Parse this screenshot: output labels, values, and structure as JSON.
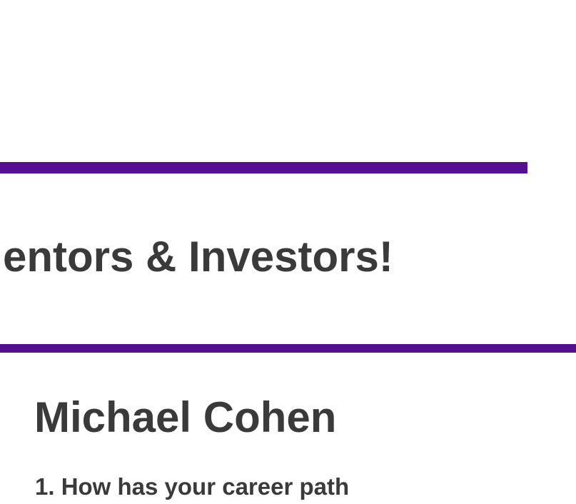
{
  "section": {
    "heading": "entors & Investors!",
    "accent_color": "#55118d"
  },
  "profile": {
    "name": "Michael Cohen",
    "question_1": "1. How has your career path"
  }
}
